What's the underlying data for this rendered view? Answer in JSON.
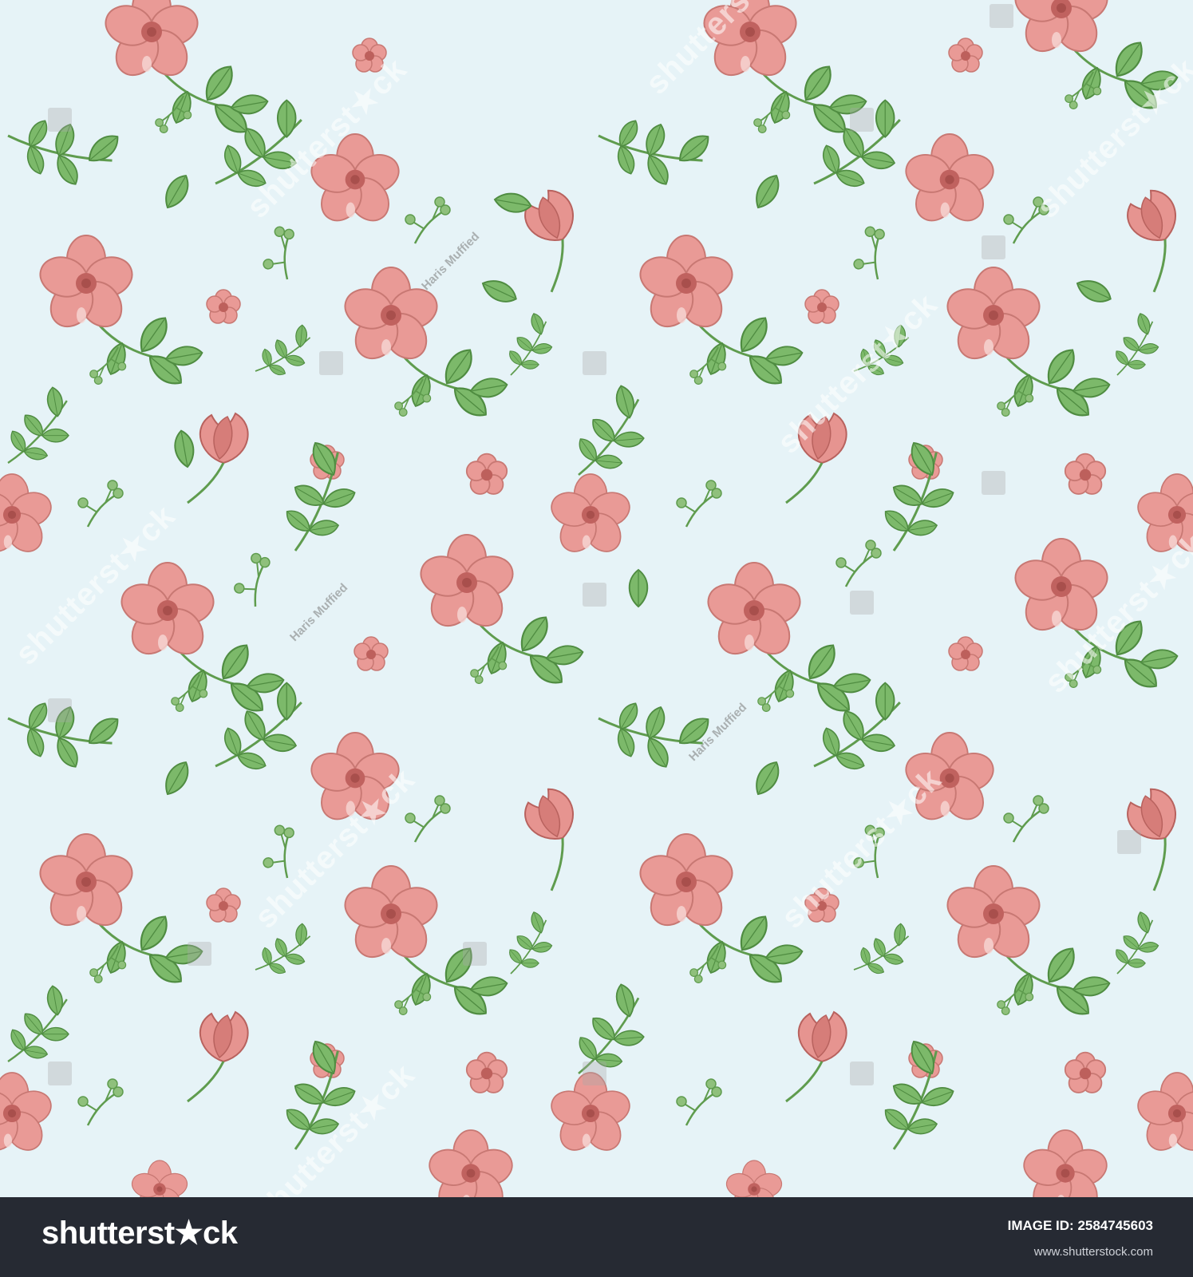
{
  "image": {
    "background_color": "#e6f3f7",
    "petal_color": "#e58f8f",
    "petal_shade_color": "#c76a6a",
    "leaf_color": "#6faf5e",
    "leaf_dark_color": "#4e8d42"
  },
  "watermark": {
    "brand_text": "shutterst★ck",
    "artist_name": "Haris Muffied"
  },
  "footer": {
    "logo": "shutterst★ck",
    "image_id_label": "IMAGE ID: 2584745603",
    "site": "www.shutterstock.com",
    "background_color": "#262a33"
  }
}
